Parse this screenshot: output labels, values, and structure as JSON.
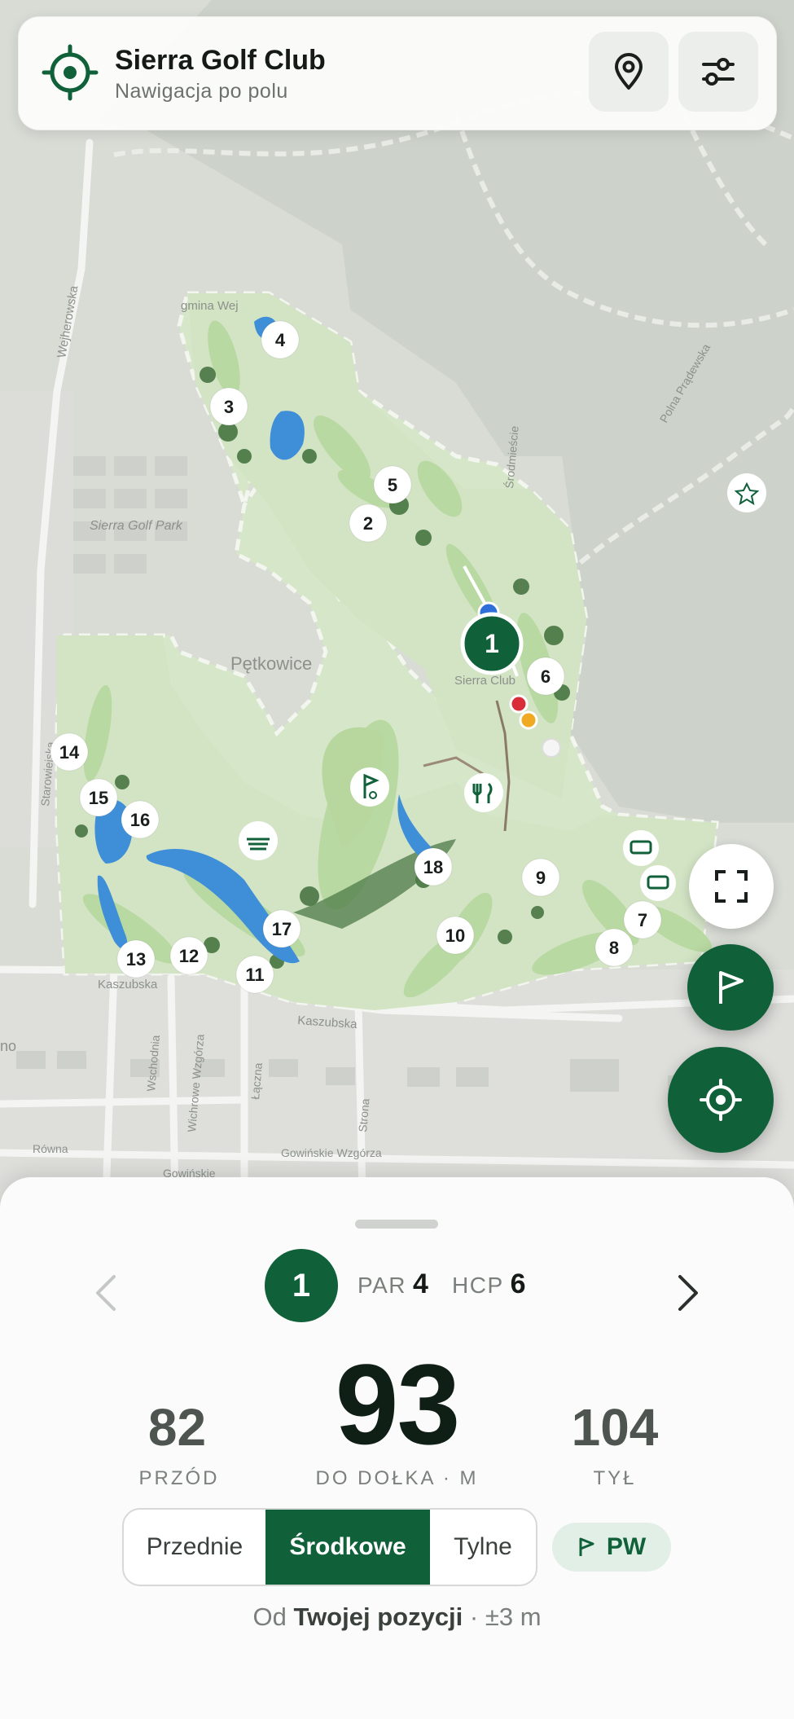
{
  "header": {
    "title": "Sierra Golf Club",
    "subtitle": "Nawigacja po polu"
  },
  "map": {
    "labels": {
      "village": "Pętkowice",
      "park": "Sierra Golf Park",
      "clubhouse": "Sierra Club",
      "street_wejherowska": "Wejherowska",
      "street_kaszubska": "Kaszubska",
      "street_kaszubska2": "Kaszubska",
      "street_wschodnia": "Wschodnia",
      "street_starowiejska": "Starowiejska",
      "street_rowna": "Równa",
      "street_gowinskie": "Gowińskie",
      "street_gowinskie_wzgorza": "Gowińskie Wzgórza",
      "street_wichrowe": "Wichrowe Wzgórza",
      "street_laczna": "Łączna",
      "street_strona": "Strona",
      "street_gminna": "gmina Wej",
      "street_srodmiescie": "Środmieście",
      "street_polnocna": "Polna Prądewska",
      "edge_no": "no"
    },
    "holes": [
      "1",
      "2",
      "3",
      "4",
      "5",
      "6",
      "7",
      "8",
      "9",
      "10",
      "11",
      "12",
      "13",
      "14",
      "15",
      "16",
      "17",
      "18"
    ],
    "current_hole": "1"
  },
  "colors": {
    "brand_green": "#10603a",
    "fairway": "#b9d9a2",
    "course": "#d6e6c9",
    "water": "#3f8fd8",
    "trees": "#3f6f3a"
  },
  "hole_info": {
    "number": "1",
    "par_label": "PAR",
    "par": "4",
    "hcp_label": "HCP",
    "hcp": "6"
  },
  "distances": {
    "front": "82",
    "front_label": "PRZÓD",
    "center": "93",
    "center_label": "DO DOŁKA · M",
    "back": "104",
    "back_label": "TYŁ"
  },
  "tee_selector": {
    "options": [
      "Przednie",
      "Środkowe",
      "Tylne"
    ],
    "selected": "Środkowe"
  },
  "club": {
    "label": "PW"
  },
  "source": {
    "prefix": "Od",
    "position": "Twojej pozycji",
    "accuracy": "· ±3 m"
  }
}
